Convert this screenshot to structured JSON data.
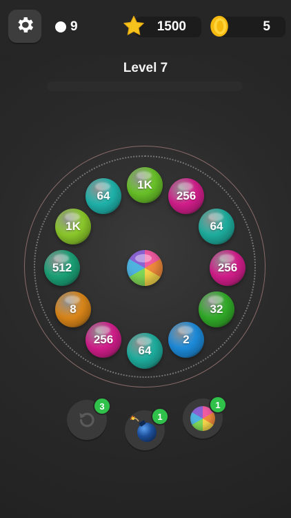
{
  "header": {
    "balls_remaining": "9",
    "stars": "1500",
    "coins": "5"
  },
  "level": {
    "title": "Level 7",
    "progress": 0.0
  },
  "board": {
    "balls": [
      {
        "label": "1K",
        "color": "#6cc72a"
      },
      {
        "label": "256",
        "color": "#d81f8f"
      },
      {
        "label": "64",
        "color": "#1fb3a3"
      },
      {
        "label": "256",
        "color": "#d81f8f"
      },
      {
        "label": "32",
        "color": "#33b12a"
      },
      {
        "label": "2",
        "color": "#1e8fe0"
      },
      {
        "label": "64",
        "color": "#1fb3a3"
      },
      {
        "label": "256",
        "color": "#d81f8f"
      },
      {
        "label": "8",
        "color": "#e08a1a"
      },
      {
        "label": "512",
        "color": "#1ca67a"
      },
      {
        "label": "1K",
        "color": "#8fce2c"
      },
      {
        "label": "64",
        "color": "#20b8b0"
      }
    ]
  },
  "powerups": {
    "undo_count": "3",
    "bomb_count": "1",
    "rainbow_count": "1"
  }
}
